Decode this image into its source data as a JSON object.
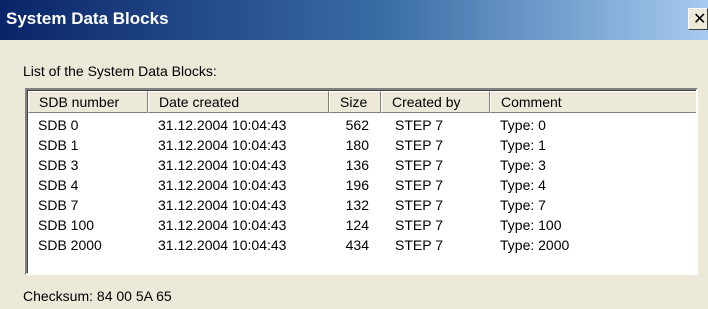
{
  "window": {
    "title": "System Data Blocks",
    "close_glyph": "✕",
    "close_icon": "close-icon"
  },
  "caption": "List of the System Data Blocks:",
  "table": {
    "columns": [
      "SDB number",
      "Date created",
      "Size",
      "Created by",
      "Comment"
    ],
    "rows": [
      [
        "SDB 0",
        "31.12.2004 10:04:43",
        "562",
        "STEP 7",
        "Type: 0"
      ],
      [
        "SDB 1",
        "31.12.2004 10:04:43",
        "180",
        "STEP 7",
        "Type: 1"
      ],
      [
        "SDB 3",
        "31.12.2004 10:04:43",
        "136",
        "STEP 7",
        "Type: 3"
      ],
      [
        "SDB 4",
        "31.12.2004 10:04:43",
        "196",
        "STEP 7",
        "Type: 4"
      ],
      [
        "SDB 7",
        "31.12.2004 10:04:43",
        "132",
        "STEP 7",
        "Type: 7"
      ],
      [
        "SDB 100",
        "31.12.2004 10:04:43",
        "124",
        "STEP 7",
        "Type: 100"
      ],
      [
        "SDB 2000",
        "31.12.2004 10:04:43",
        "434",
        "STEP 7",
        "Type: 2000"
      ]
    ]
  },
  "checksum": "Checksum: 84 00 5A 65",
  "colors": {
    "titlebar_start": "#0a246a",
    "titlebar_end": "#a6caf0",
    "dialog_bg": "#ece9d8",
    "list_bg": "#ffffff"
  }
}
